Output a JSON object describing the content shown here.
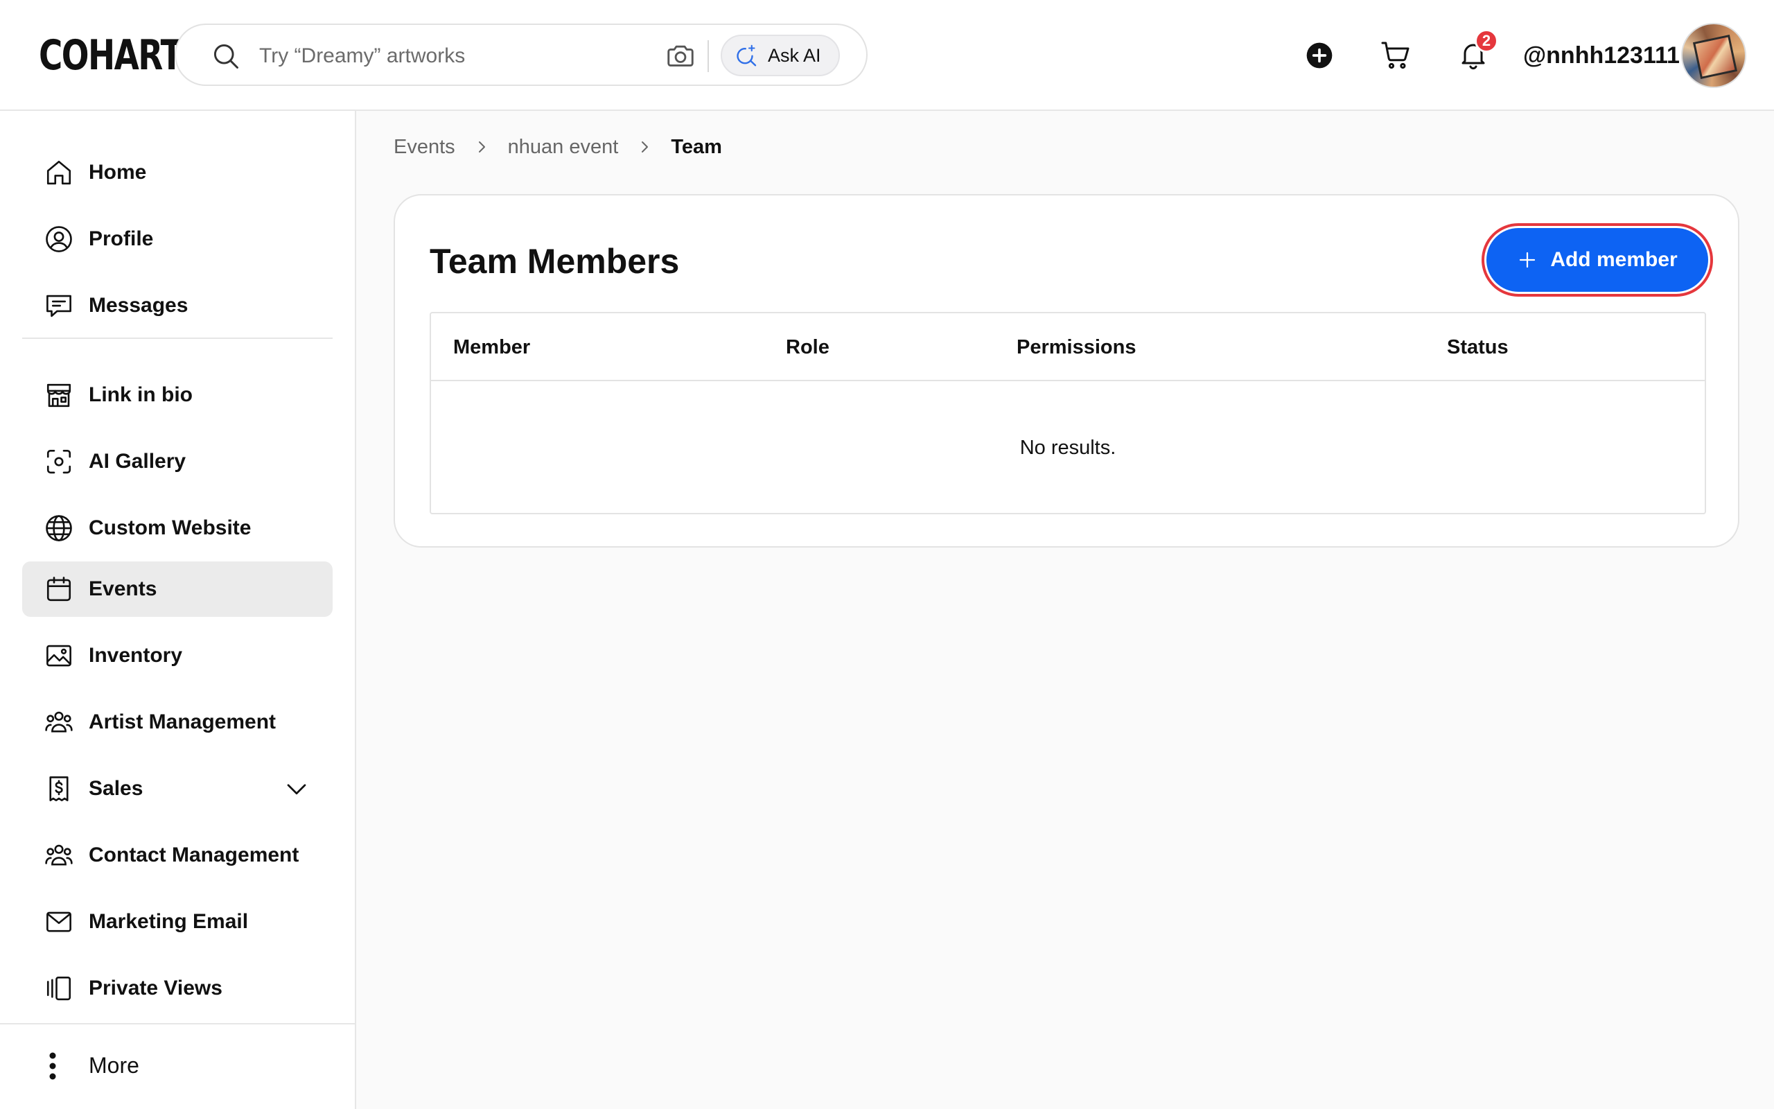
{
  "app": {
    "logo": "COHART"
  },
  "header": {
    "search_placeholder": "Try “Dreamy” artworks",
    "ask_ai_label": "Ask AI",
    "notification_count": "2",
    "username": "@nnhh123111"
  },
  "sidebar": {
    "primary": [
      {
        "label": "Home",
        "icon": "home-icon"
      },
      {
        "label": "Profile",
        "icon": "user-circle-icon"
      },
      {
        "label": "Messages",
        "icon": "message-icon"
      }
    ],
    "secondary": [
      {
        "label": "Link in bio",
        "icon": "storefront-icon"
      },
      {
        "label": "AI Gallery",
        "icon": "scan-icon"
      },
      {
        "label": "Custom Website",
        "icon": "globe-icon"
      },
      {
        "label": "Events",
        "icon": "calendar-icon",
        "active": true
      },
      {
        "label": "Inventory",
        "icon": "image-icon"
      },
      {
        "label": "Artist Management",
        "icon": "users-icon"
      },
      {
        "label": "Sales",
        "icon": "receipt-dollar-icon",
        "expandable": true
      },
      {
        "label": "Contact Management",
        "icon": "users-icon"
      },
      {
        "label": "Marketing Email",
        "icon": "mail-icon"
      },
      {
        "label": "Private Views",
        "icon": "gallery-view-icon"
      }
    ],
    "more_label": "More"
  },
  "breadcrumb": {
    "items": [
      "Events",
      "nhuan event"
    ],
    "current": "Team"
  },
  "main": {
    "title": "Team Members",
    "add_member_label": "Add member",
    "table": {
      "columns": [
        "Member",
        "Role",
        "Permissions",
        "Status"
      ],
      "empty_text": "No results."
    }
  },
  "colors": {
    "accent": "#0d63f3",
    "highlight_ring": "#e5373d",
    "badge": "#e5373d",
    "active_nav_bg": "#ebebeb"
  }
}
